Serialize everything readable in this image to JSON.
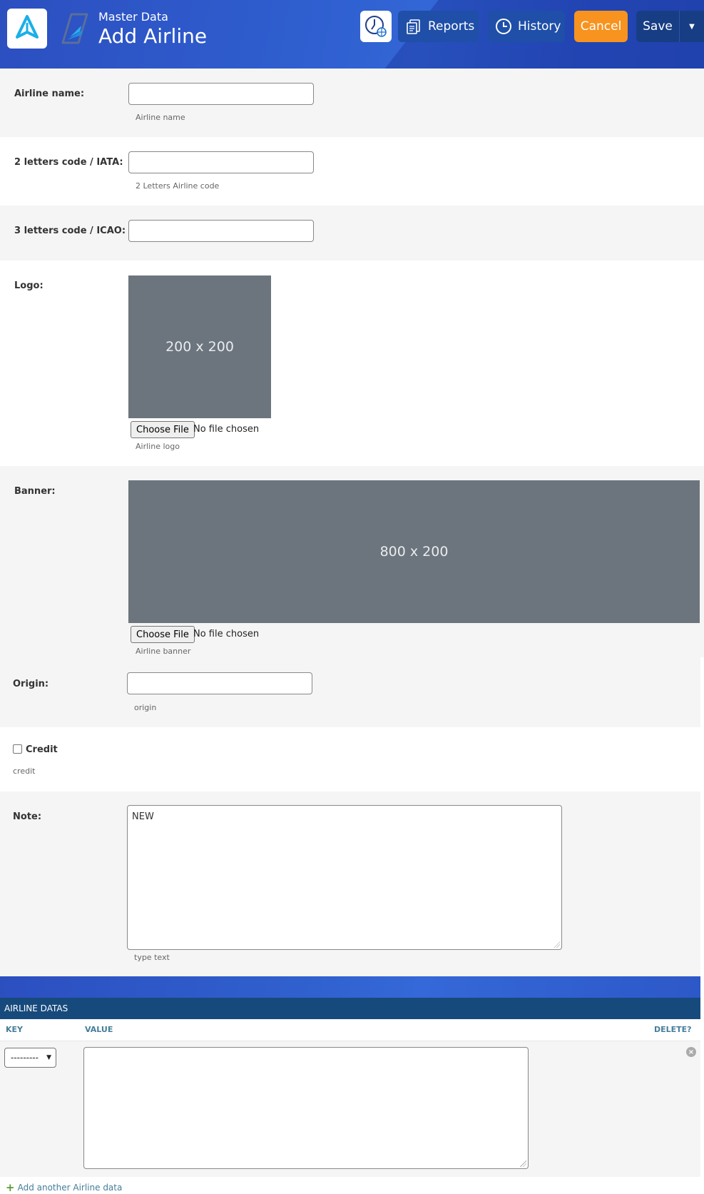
{
  "header": {
    "subtitle": "Master Data",
    "title": "Add Airline",
    "buttons": {
      "reports": "Reports",
      "history": "History",
      "cancel": "Cancel",
      "save": "Save"
    }
  },
  "form": {
    "airline_name": {
      "label": "Airline name:",
      "value": "",
      "help": "Airline name"
    },
    "iata": {
      "label": "2 letters code / IATA:",
      "value": "",
      "help": "2 Letters Airline code"
    },
    "icao": {
      "label": "3 letters code / ICAO:",
      "value": ""
    },
    "logo": {
      "label": "Logo:",
      "placeholder": "200 x 200",
      "file_button": "Choose File",
      "file_status": "No file chosen",
      "help": "Airline logo"
    },
    "banner": {
      "label": "Banner:",
      "placeholder": "800 x 200",
      "file_button": "Choose File",
      "file_status": "No file chosen",
      "help": "Airline banner"
    },
    "origin": {
      "label": "Origin:",
      "value": "",
      "help": "origin"
    },
    "credit": {
      "label": "Credit",
      "checked": false,
      "help": "credit"
    },
    "note": {
      "label": "Note:",
      "value": "NEW",
      "help": "type text"
    }
  },
  "inline": {
    "title": "AIRLINE DATAS",
    "columns": {
      "key": "KEY",
      "value": "VALUE",
      "delete": "DELETE?"
    },
    "row": {
      "key_selected": "---------",
      "value": ""
    },
    "add_link": "Add another Airline data"
  },
  "colors": {
    "header_blue": "#2f5fd0",
    "button_dark": "#173d84",
    "cancel_orange": "#f7931e",
    "section_head": "#174a7c",
    "placeholder_grey": "#6c757d"
  }
}
